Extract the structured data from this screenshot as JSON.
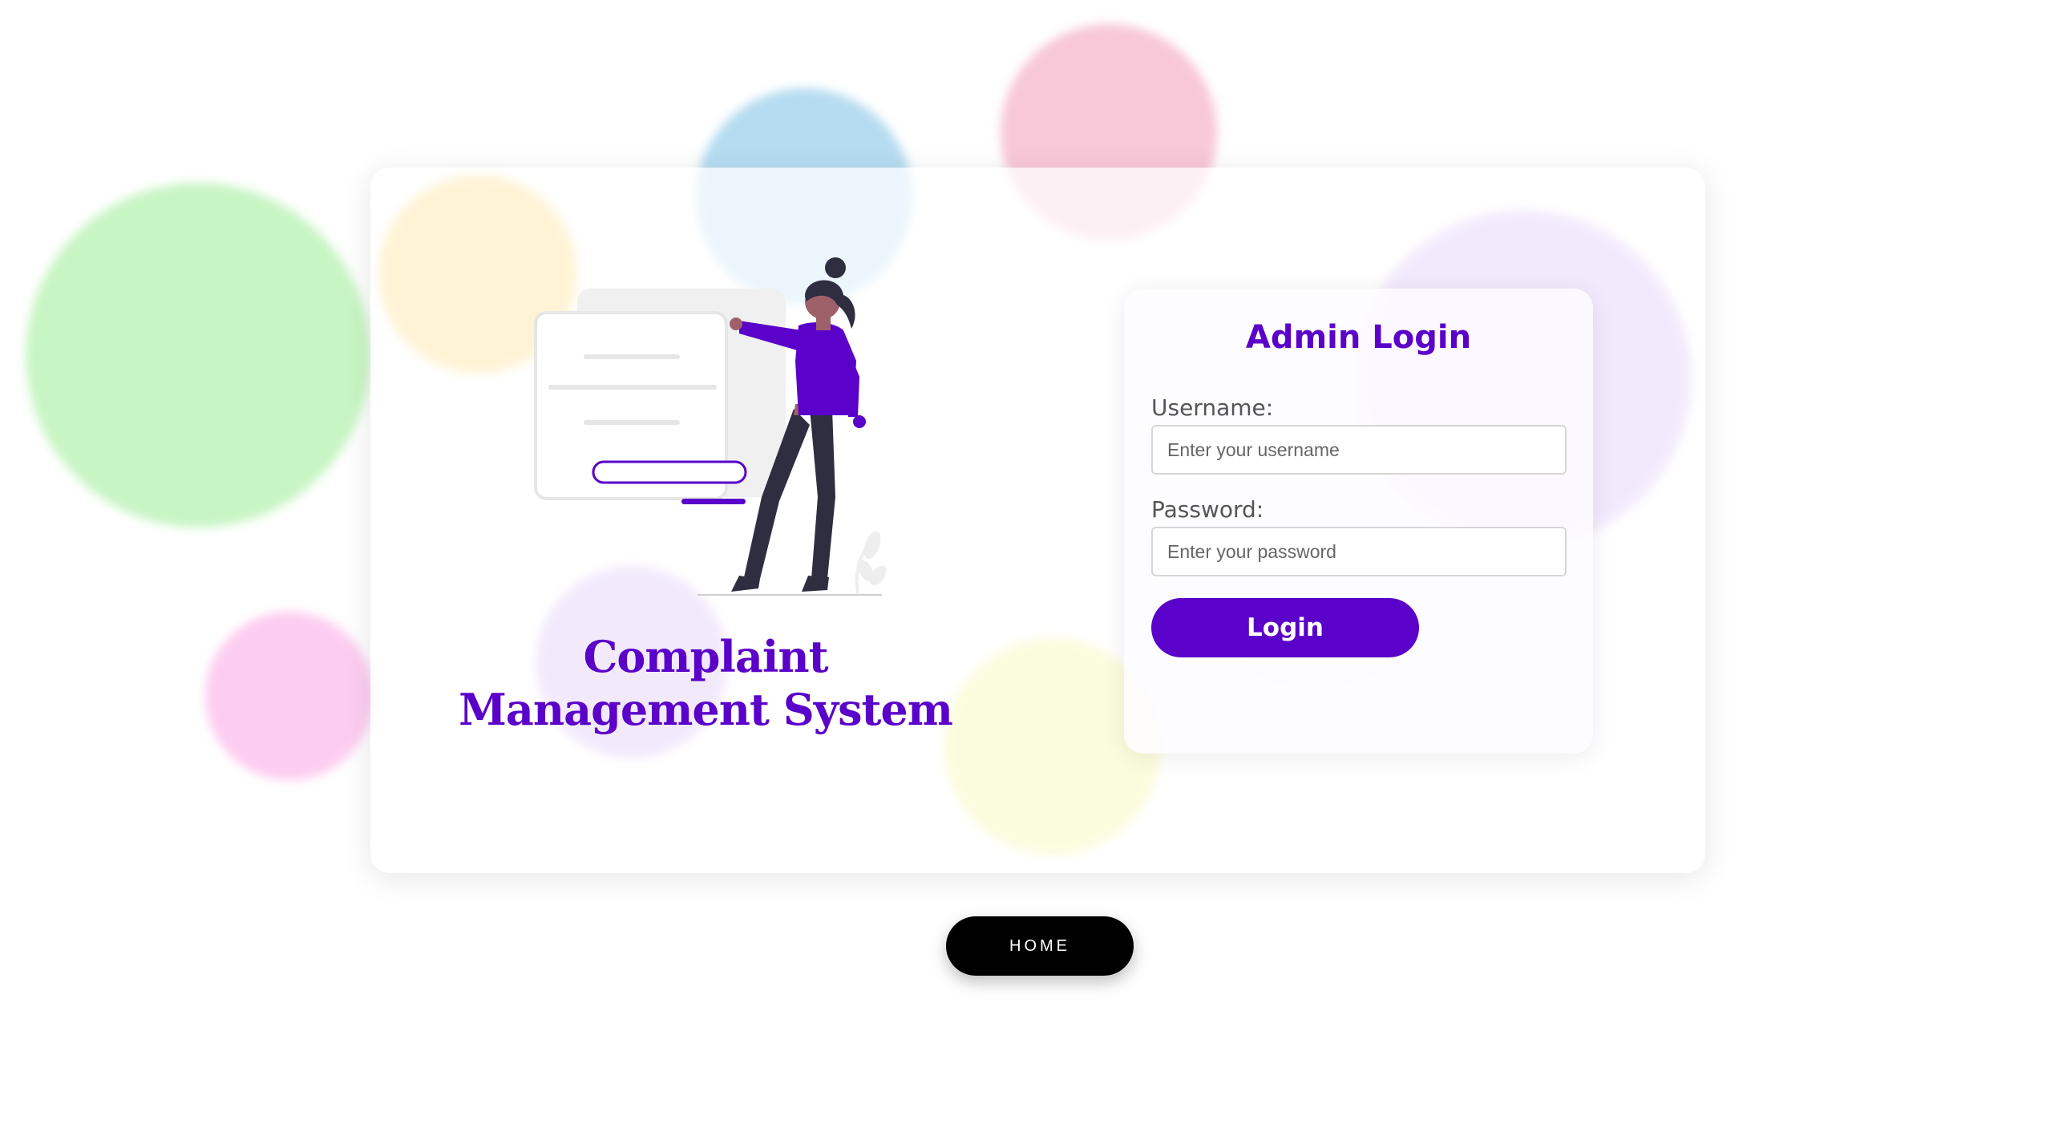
{
  "app": {
    "title": "Complaint Management System"
  },
  "login": {
    "heading": "Admin Login",
    "username_label": "Username:",
    "username_placeholder": "Enter your username",
    "username_value": "",
    "password_label": "Password:",
    "password_placeholder": "Enter your password",
    "password_value": "",
    "submit_label": "Login"
  },
  "nav": {
    "home_label": "HOME"
  },
  "colors": {
    "accent": "#5a02c9",
    "home_button": "#000000",
    "card_background": "#ffffff"
  },
  "illustration": {
    "icon": "person-with-login-form-illustration"
  }
}
